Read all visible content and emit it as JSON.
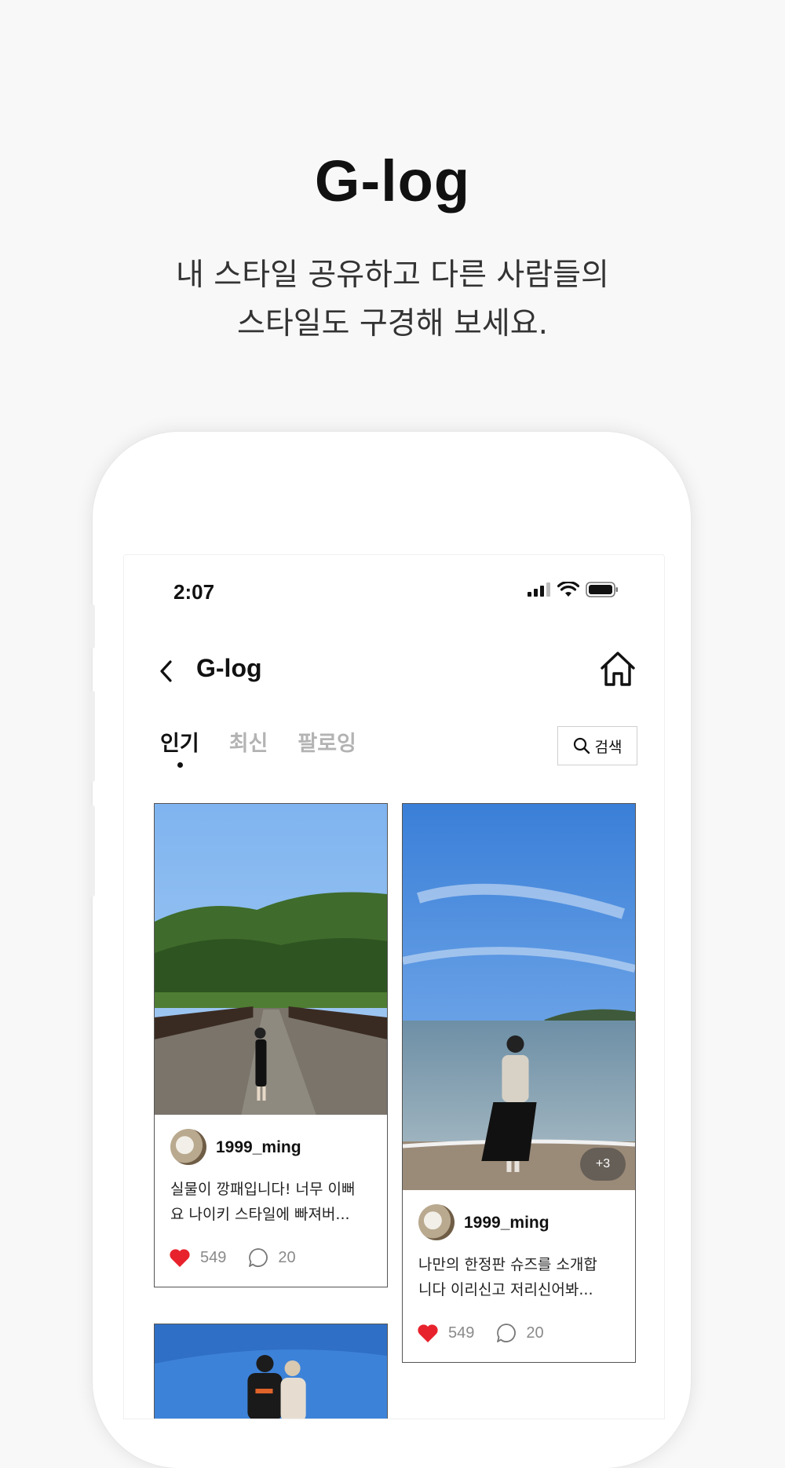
{
  "hero": {
    "title": "G-log",
    "subtitle_line1": "내 스타일 공유하고 다른 사람들의",
    "subtitle_line2": "스타일도 구경해 보세요."
  },
  "status_bar": {
    "time": "2:07"
  },
  "header": {
    "title": "G-log",
    "back_icon": "chevron-left-icon",
    "home_icon": "home-icon"
  },
  "tabs": [
    {
      "label": "인기",
      "active": true
    },
    {
      "label": "최신",
      "active": false
    },
    {
      "label": "팔로잉",
      "active": false
    }
  ],
  "search": {
    "label": "검색"
  },
  "posts": [
    {
      "username": "1999_ming",
      "caption_line1": "실물이 깡패입니다! 너무 이뻐",
      "caption_line2": "요 나이키 스타일에 빠져버...",
      "likes": "549",
      "comments": "20"
    },
    {
      "username": "1999_ming",
      "caption_line1": "나만의 한정판 슈즈를 소개합",
      "caption_line2": "니다 이리신고 저리신어봐...",
      "likes": "549",
      "comments": "20",
      "more_photos": "+3"
    }
  ],
  "colors": {
    "like": "#e8222c",
    "accent": "#111111"
  }
}
